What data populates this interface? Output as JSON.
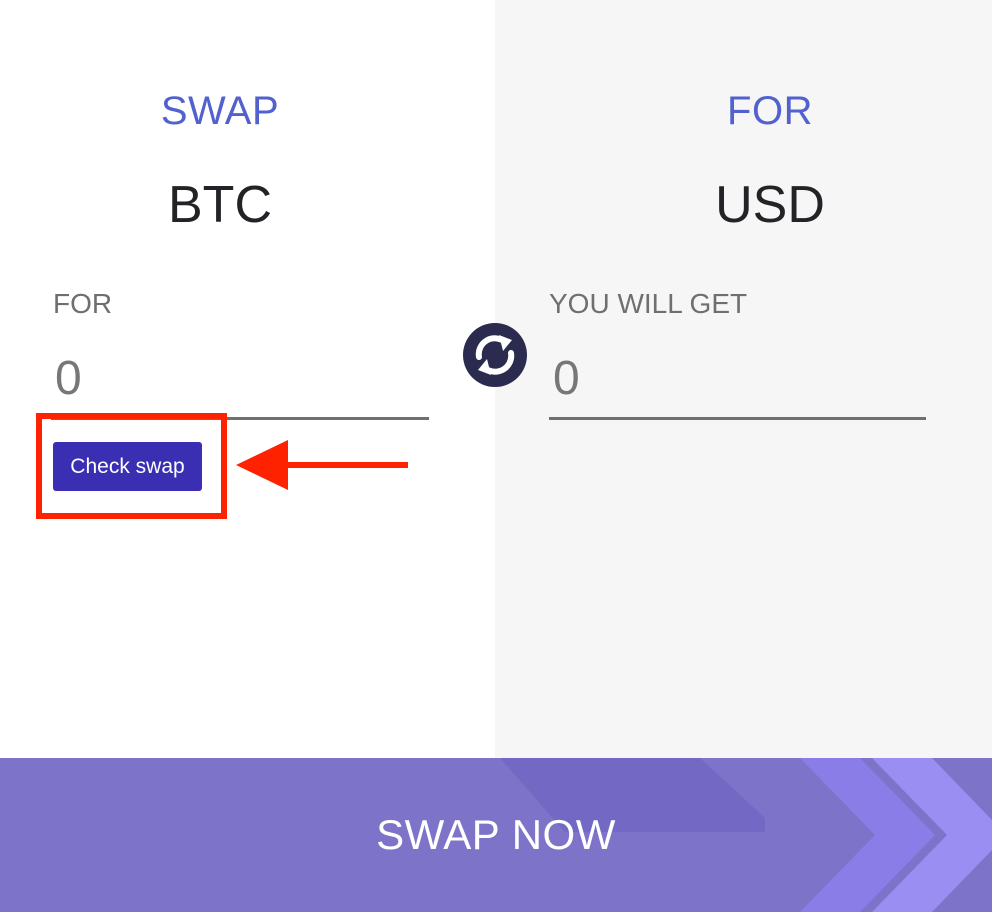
{
  "swap": {
    "heading": "SWAP",
    "currency": "BTC",
    "field_label": "FOR",
    "value": "0"
  },
  "receive": {
    "heading": "FOR",
    "currency": "USD",
    "field_label": "YOU WILL GET",
    "value": "0"
  },
  "check_button": {
    "label": "Check swap"
  },
  "swap_now_button": {
    "label": "SWAP NOW"
  },
  "icons": {
    "exchange": "exchange-arrows-icon",
    "pointer": "red-arrow-left-icon"
  },
  "colors": {
    "heading": "#5361cf",
    "button": "#3a2fb3",
    "swap_now_bg": "#7d74c9",
    "highlight": "#ff2200",
    "icon_bg": "#2a2b4f"
  }
}
